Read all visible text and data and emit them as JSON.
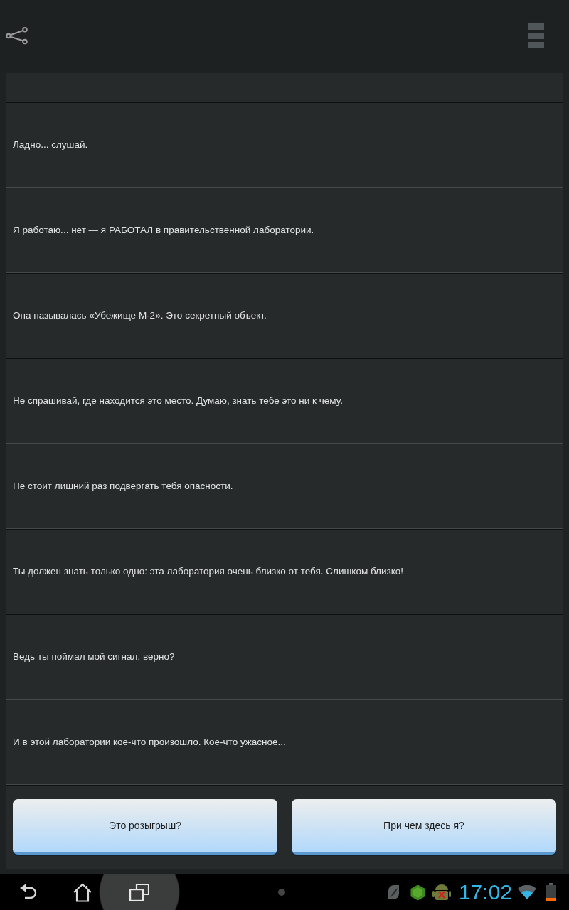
{
  "messages": [
    "Ладно... слушай.",
    "Я работаю... нет — я РАБОТАЛ в правительственной лаборатории.",
    "Она называлась «Убежище М-2». Это секретный объект.",
    "Не спрашивай, где находится это место. Думаю, знать тебе это ни к чему.",
    "Не стоит лишний раз подвергать тебя опасности.",
    "Ты должен знать только одно: эта лаборатория очень близко от тебя. Слишком близко!",
    "Ведь ты поймал мой сигнал, верно?",
    "И в этой лаборатории кое-что произошло. Кое-что ужасное..."
  ],
  "answers": [
    "Это розыгрыш?",
    "При чем здесь я?"
  ],
  "nav_bar": {
    "buttons": [
      {
        "kind": "back",
        "pressed": false
      },
      {
        "kind": "home",
        "pressed": false
      },
      {
        "kind": "recent",
        "pressed": true
      }
    ]
  },
  "status": {
    "notifications": [
      {
        "kind": "leaf"
      },
      {
        "kind": "hexagon"
      },
      {
        "kind": "robot-error"
      }
    ],
    "time": "17:02"
  }
}
